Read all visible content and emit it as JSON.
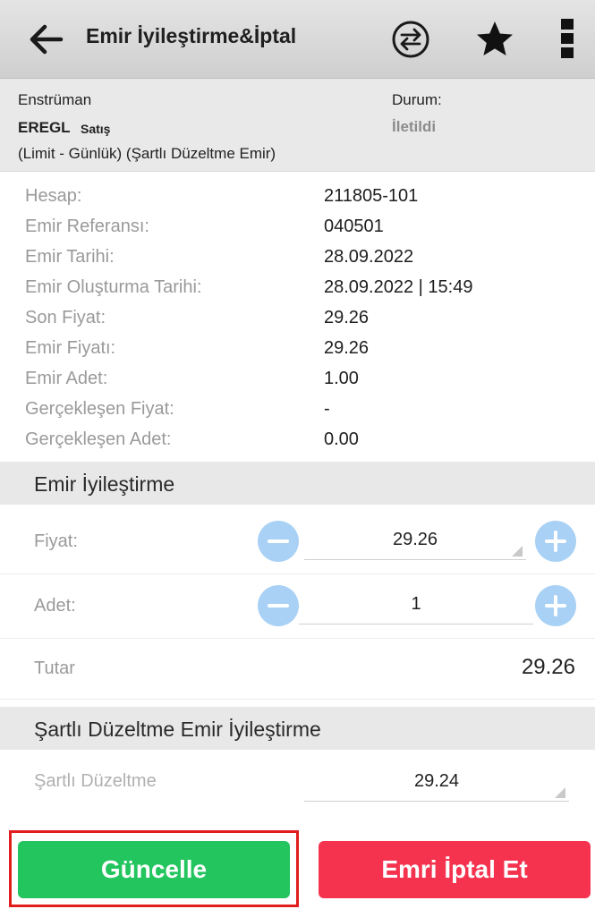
{
  "header": {
    "title": "Emir İyileştirme&İptal",
    "icons": {
      "back": "arrow-left-icon",
      "swap": "swap-arrows-icon",
      "favorite": "star-icon",
      "more": "more-vertical-icon"
    }
  },
  "order_summary": {
    "instrument_label": "Enstrüman",
    "symbol": "EREGL",
    "side": "Satış",
    "order_type": "(Limit - Günlük)  (Şartlı Düzeltme Emir)",
    "status_label": "Durum:",
    "status": "İletildi"
  },
  "details": [
    {
      "label": "Hesap:",
      "value": "211805-101"
    },
    {
      "label": "Emir Referansı:",
      "value": "040501"
    },
    {
      "label": "Emir Tarihi:",
      "value": "28.09.2022"
    },
    {
      "label": "Emir Oluşturma Tarihi:",
      "value": "28.09.2022 | 15:49"
    },
    {
      "label": "Son Fiyat:",
      "value": "29.26"
    },
    {
      "label": "Emir Fiyatı:",
      "value": "29.26"
    },
    {
      "label": "Emir Adet:",
      "value": "1.00"
    },
    {
      "label": "Gerçekleşen Fiyat:",
      "value": "-"
    },
    {
      "label": "Gerçekleşen Adet:",
      "value": "0.00"
    }
  ],
  "improve": {
    "section_title": "Emir İyileştirme",
    "price_label": "Fiyat:",
    "price_value": "29.26",
    "qty_label": "Adet:",
    "qty_value": "1",
    "total_label": "Tutar",
    "total_value": "29.26"
  },
  "conditional": {
    "section_title": "Şartlı Düzeltme Emir İyileştirme",
    "label": "Şartlı Düzeltme",
    "value": "29.24"
  },
  "buttons": {
    "update": "Güncelle",
    "cancel": "Emri İptal Et"
  },
  "colors": {
    "update": "#22c55e",
    "cancel": "#f5334f",
    "stepper": "#a9d1f5",
    "highlight": "#e11c1c"
  }
}
